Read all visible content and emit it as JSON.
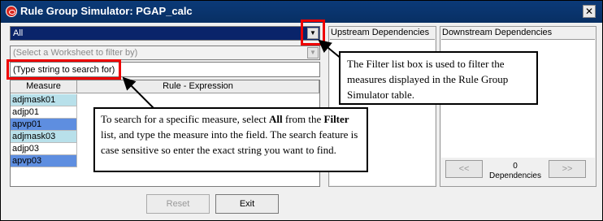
{
  "window": {
    "title": "Rule Group Simulator: PGAP_calc",
    "close_label": "✕"
  },
  "filter": {
    "selected": "All",
    "worksheet_placeholder": "(Select a Worksheet to filter by)"
  },
  "search": {
    "value": "(Type string to search for)"
  },
  "table": {
    "headers": [
      "Measure",
      "Rule - Expression"
    ],
    "rows": [
      {
        "measure": "adjmask01",
        "style": "lt"
      },
      {
        "measure": "adjp01",
        "style": "wh"
      },
      {
        "measure": "apvp01",
        "style": "hl"
      },
      {
        "measure": "adjmask03",
        "style": "lt"
      },
      {
        "measure": "adjp03",
        "style": "wh"
      },
      {
        "measure": "apvp03",
        "style": "hl"
      }
    ]
  },
  "upstream": {
    "title": "Upstream Dependencies"
  },
  "downstream": {
    "title": "Downstream Dependencies",
    "prev_label": "<<",
    "next_label": ">>",
    "count": "0",
    "count_label": "Dependencies"
  },
  "buttons": {
    "reset": "Reset",
    "exit": "Exit"
  },
  "callouts": {
    "filter": "The Filter list box is used to filter the measures displayed in the Rule Group Simulator table.",
    "search_prefix": "To search for a specific measure, select ",
    "search_bold1": "All",
    "search_mid": " from the ",
    "search_bold2": "Filter",
    "search_suffix": " list, and type the measure into the field. The search feature is case sensitive so enter the exact string you want to find."
  },
  "colors": {
    "titlebar": "#0b3a78",
    "highlight_row": "#5e8ee0",
    "light_row": "#b8e0ea",
    "annotation": "#e00000"
  }
}
